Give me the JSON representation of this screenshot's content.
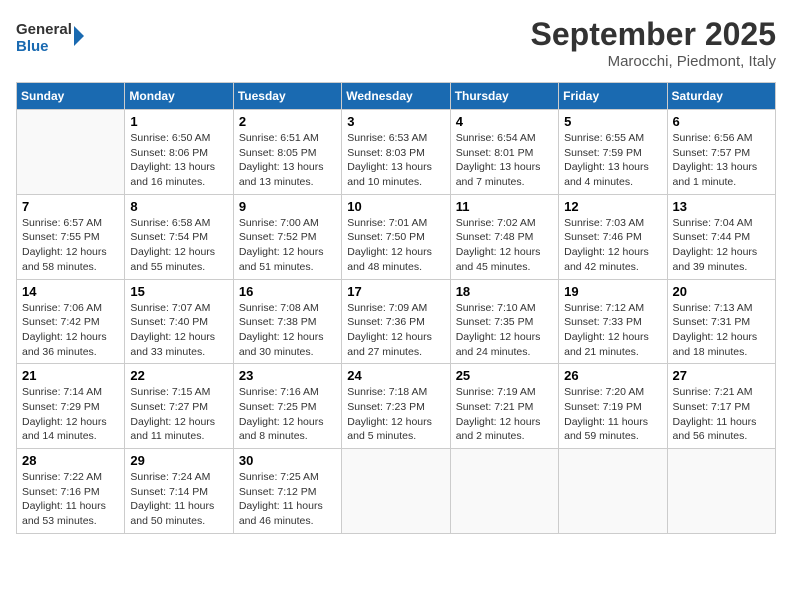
{
  "header": {
    "logo_line1": "General",
    "logo_line2": "Blue",
    "month_title": "September 2025",
    "location": "Marocchi, Piedmont, Italy"
  },
  "days_of_week": [
    "Sunday",
    "Monday",
    "Tuesday",
    "Wednesday",
    "Thursday",
    "Friday",
    "Saturday"
  ],
  "weeks": [
    [
      {
        "day": "",
        "info": ""
      },
      {
        "day": "1",
        "info": "Sunrise: 6:50 AM\nSunset: 8:06 PM\nDaylight: 13 hours\nand 16 minutes."
      },
      {
        "day": "2",
        "info": "Sunrise: 6:51 AM\nSunset: 8:05 PM\nDaylight: 13 hours\nand 13 minutes."
      },
      {
        "day": "3",
        "info": "Sunrise: 6:53 AM\nSunset: 8:03 PM\nDaylight: 13 hours\nand 10 minutes."
      },
      {
        "day": "4",
        "info": "Sunrise: 6:54 AM\nSunset: 8:01 PM\nDaylight: 13 hours\nand 7 minutes."
      },
      {
        "day": "5",
        "info": "Sunrise: 6:55 AM\nSunset: 7:59 PM\nDaylight: 13 hours\nand 4 minutes."
      },
      {
        "day": "6",
        "info": "Sunrise: 6:56 AM\nSunset: 7:57 PM\nDaylight: 13 hours\nand 1 minute."
      }
    ],
    [
      {
        "day": "7",
        "info": "Sunrise: 6:57 AM\nSunset: 7:55 PM\nDaylight: 12 hours\nand 58 minutes."
      },
      {
        "day": "8",
        "info": "Sunrise: 6:58 AM\nSunset: 7:54 PM\nDaylight: 12 hours\nand 55 minutes."
      },
      {
        "day": "9",
        "info": "Sunrise: 7:00 AM\nSunset: 7:52 PM\nDaylight: 12 hours\nand 51 minutes."
      },
      {
        "day": "10",
        "info": "Sunrise: 7:01 AM\nSunset: 7:50 PM\nDaylight: 12 hours\nand 48 minutes."
      },
      {
        "day": "11",
        "info": "Sunrise: 7:02 AM\nSunset: 7:48 PM\nDaylight: 12 hours\nand 45 minutes."
      },
      {
        "day": "12",
        "info": "Sunrise: 7:03 AM\nSunset: 7:46 PM\nDaylight: 12 hours\nand 42 minutes."
      },
      {
        "day": "13",
        "info": "Sunrise: 7:04 AM\nSunset: 7:44 PM\nDaylight: 12 hours\nand 39 minutes."
      }
    ],
    [
      {
        "day": "14",
        "info": "Sunrise: 7:06 AM\nSunset: 7:42 PM\nDaylight: 12 hours\nand 36 minutes."
      },
      {
        "day": "15",
        "info": "Sunrise: 7:07 AM\nSunset: 7:40 PM\nDaylight: 12 hours\nand 33 minutes."
      },
      {
        "day": "16",
        "info": "Sunrise: 7:08 AM\nSunset: 7:38 PM\nDaylight: 12 hours\nand 30 minutes."
      },
      {
        "day": "17",
        "info": "Sunrise: 7:09 AM\nSunset: 7:36 PM\nDaylight: 12 hours\nand 27 minutes."
      },
      {
        "day": "18",
        "info": "Sunrise: 7:10 AM\nSunset: 7:35 PM\nDaylight: 12 hours\nand 24 minutes."
      },
      {
        "day": "19",
        "info": "Sunrise: 7:12 AM\nSunset: 7:33 PM\nDaylight: 12 hours\nand 21 minutes."
      },
      {
        "day": "20",
        "info": "Sunrise: 7:13 AM\nSunset: 7:31 PM\nDaylight: 12 hours\nand 18 minutes."
      }
    ],
    [
      {
        "day": "21",
        "info": "Sunrise: 7:14 AM\nSunset: 7:29 PM\nDaylight: 12 hours\nand 14 minutes."
      },
      {
        "day": "22",
        "info": "Sunrise: 7:15 AM\nSunset: 7:27 PM\nDaylight: 12 hours\nand 11 minutes."
      },
      {
        "day": "23",
        "info": "Sunrise: 7:16 AM\nSunset: 7:25 PM\nDaylight: 12 hours\nand 8 minutes."
      },
      {
        "day": "24",
        "info": "Sunrise: 7:18 AM\nSunset: 7:23 PM\nDaylight: 12 hours\nand 5 minutes."
      },
      {
        "day": "25",
        "info": "Sunrise: 7:19 AM\nSunset: 7:21 PM\nDaylight: 12 hours\nand 2 minutes."
      },
      {
        "day": "26",
        "info": "Sunrise: 7:20 AM\nSunset: 7:19 PM\nDaylight: 11 hours\nand 59 minutes."
      },
      {
        "day": "27",
        "info": "Sunrise: 7:21 AM\nSunset: 7:17 PM\nDaylight: 11 hours\nand 56 minutes."
      }
    ],
    [
      {
        "day": "28",
        "info": "Sunrise: 7:22 AM\nSunset: 7:16 PM\nDaylight: 11 hours\nand 53 minutes."
      },
      {
        "day": "29",
        "info": "Sunrise: 7:24 AM\nSunset: 7:14 PM\nDaylight: 11 hours\nand 50 minutes."
      },
      {
        "day": "30",
        "info": "Sunrise: 7:25 AM\nSunset: 7:12 PM\nDaylight: 11 hours\nand 46 minutes."
      },
      {
        "day": "",
        "info": ""
      },
      {
        "day": "",
        "info": ""
      },
      {
        "day": "",
        "info": ""
      },
      {
        "day": "",
        "info": ""
      }
    ]
  ]
}
